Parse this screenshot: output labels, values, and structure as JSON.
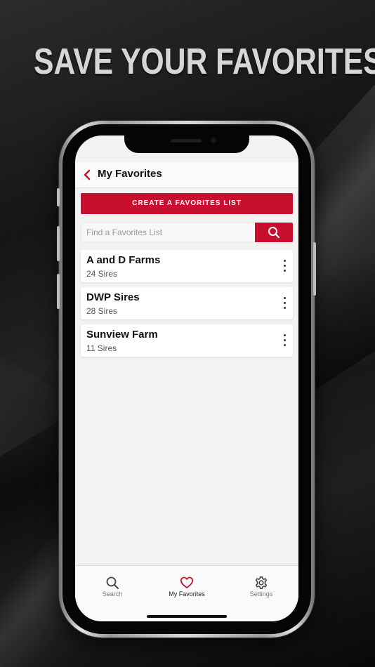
{
  "headline": "SAVE YOUR FAVORITES",
  "colors": {
    "accent": "#c8102e",
    "screen_bg": "#f2f2f2",
    "card_bg": "#ffffff"
  },
  "nav": {
    "back_icon": "chevron-left-icon",
    "title": "My Favorites"
  },
  "create_button": {
    "label": "CREATE A FAVORITES LIST"
  },
  "search": {
    "placeholder": "Find a Favorites List",
    "icon": "search-icon"
  },
  "lists": [
    {
      "name": "A and D Farms",
      "count": "24 Sires"
    },
    {
      "name": "DWP Sires",
      "count": "28 Sires"
    },
    {
      "name": "Sunview Farm",
      "count": "11 Sires"
    }
  ],
  "tabs": [
    {
      "label": "Search",
      "icon": "search-icon",
      "active": false
    },
    {
      "label": "My Favorites",
      "icon": "heart-icon",
      "active": true
    },
    {
      "label": "Settings",
      "icon": "gear-icon",
      "active": false
    }
  ]
}
